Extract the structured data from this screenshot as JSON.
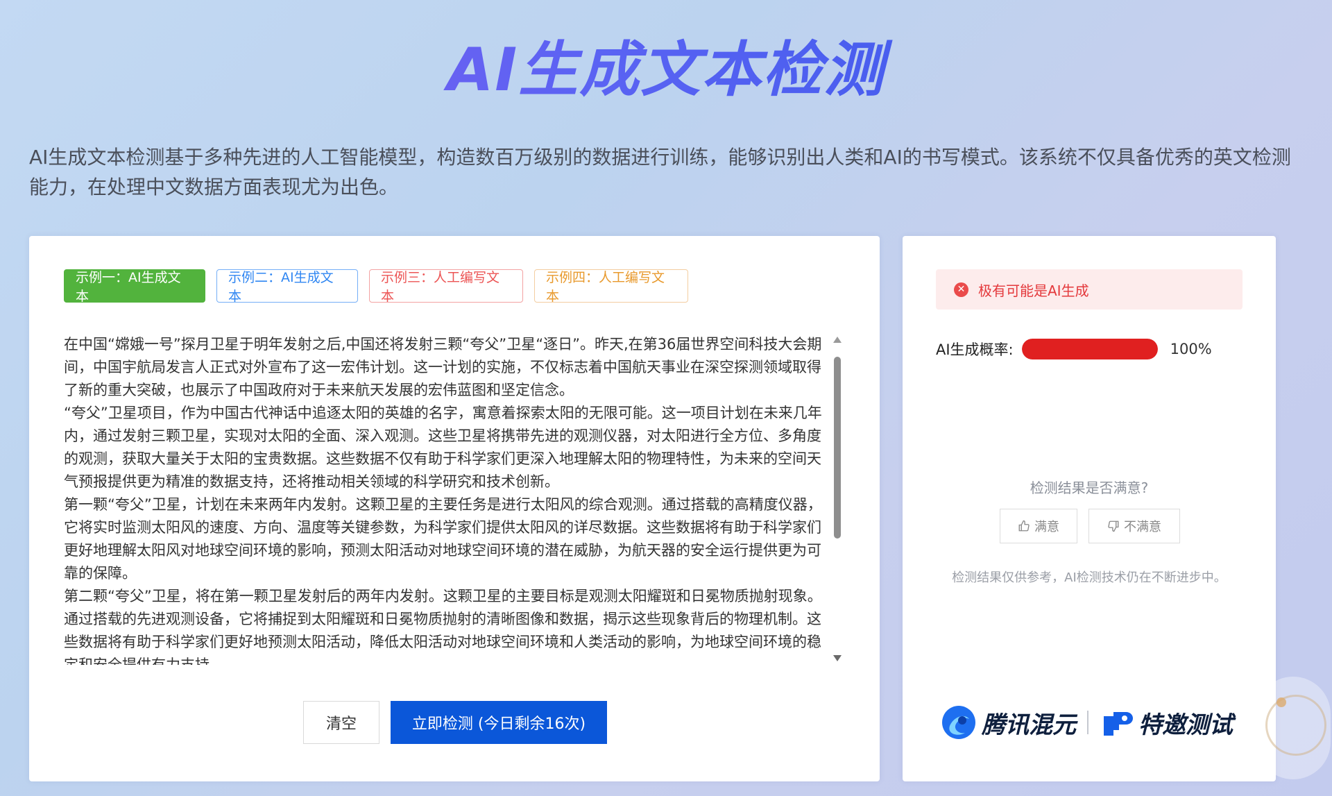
{
  "header": {
    "title": "AI生成文本检测",
    "description": "AI生成文本检测基于多种先进的人工智能模型，构造数百万级别的数据进行训练，能够识别出人类和AI的书写模式。该系统不仅具备优秀的英文检测能力，在处理中文数据方面表现尤为出色。"
  },
  "examples": [
    {
      "label": "示例一：AI生成文本",
      "color": "#52b33d",
      "selected": true
    },
    {
      "label": "示例二：AI生成文本",
      "color": "#2f86f2",
      "selected": false
    },
    {
      "label": "示例三：人工编写文本",
      "color": "#ec5454",
      "selected": false
    },
    {
      "label": "示例四：人工编写文本",
      "color": "#e8992c",
      "selected": false
    }
  ],
  "input": {
    "paragraphs": [
      "在中国“嫦娥一号”探月卫星于明年发射之后,中国还将发射三颗“夸父”卫星“逐日”。昨天,在第36届世界空间科技大会期间，中国宇航局发言人正式对外宣布了这一宏伟计划。这一计划的实施，不仅标志着中国航天事业在深空探测领域取得了新的重大突破，也展示了中国政府对于未来航天发展的宏伟蓝图和坚定信念。",
      "“夸父”卫星项目，作为中国古代神话中追逐太阳的英雄的名字，寓意着探索太阳的无限可能。这一项目计划在未来几年内，通过发射三颗卫星，实现对太阳的全面、深入观测。这些卫星将携带先进的观测仪器，对太阳进行全方位、多角度的观测，获取大量关于太阳的宝贵数据。这些数据不仅有助于科学家们更深入地理解太阳的物理特性，为未来的空间天气预报提供更为精准的数据支持，还将推动相关领域的科学研究和技术创新。",
      "第一颗“夸父”卫星，计划在未来两年内发射。这颗卫星的主要任务是进行太阳风的综合观测。通过搭载的高精度仪器，它将实时监测太阳风的速度、方向、温度等关键参数，为科学家们提供太阳风的详尽数据。这些数据将有助于科学家们更好地理解太阳风对地球空间环境的影响，预测太阳活动对地球空间环境的潜在威胁，为航天器的安全运行提供更为可靠的保障。",
      "第二颗“夸父”卫星，将在第一颗卫星发射后的两年内发射。这颗卫星的主要目标是观测太阳耀斑和日冕物质抛射现象。通过搭载的先进观测设备，它将捕捉到太阳耀斑和日冕物质抛射的清晰图像和数据，揭示这些现象背后的物理机制。这些数据将有助于科学家们更好地预测太阳活动，降低太阳活动对地球空间环境和人类活动的影响，为地球空间环境的稳定和安全提供有力支持。"
    ]
  },
  "actions": {
    "clear": "清空",
    "detect": "立即检测 (今日剩余16次)"
  },
  "result": {
    "verdict": "极有可能是AI生成",
    "verdict_color": "#e4393c",
    "probability_label": "AI生成概率:",
    "probability_value": "100%",
    "probability": 1.0,
    "bar_color": "#e02020"
  },
  "feedback": {
    "question": "检测结果是否满意?",
    "good": "满意",
    "bad": "不满意",
    "disclaimer": "检测结果仅供参考，AI检测技术仍在不断进步中。"
  },
  "brand": {
    "left": "腾讯混元",
    "right": "特邀测试"
  }
}
